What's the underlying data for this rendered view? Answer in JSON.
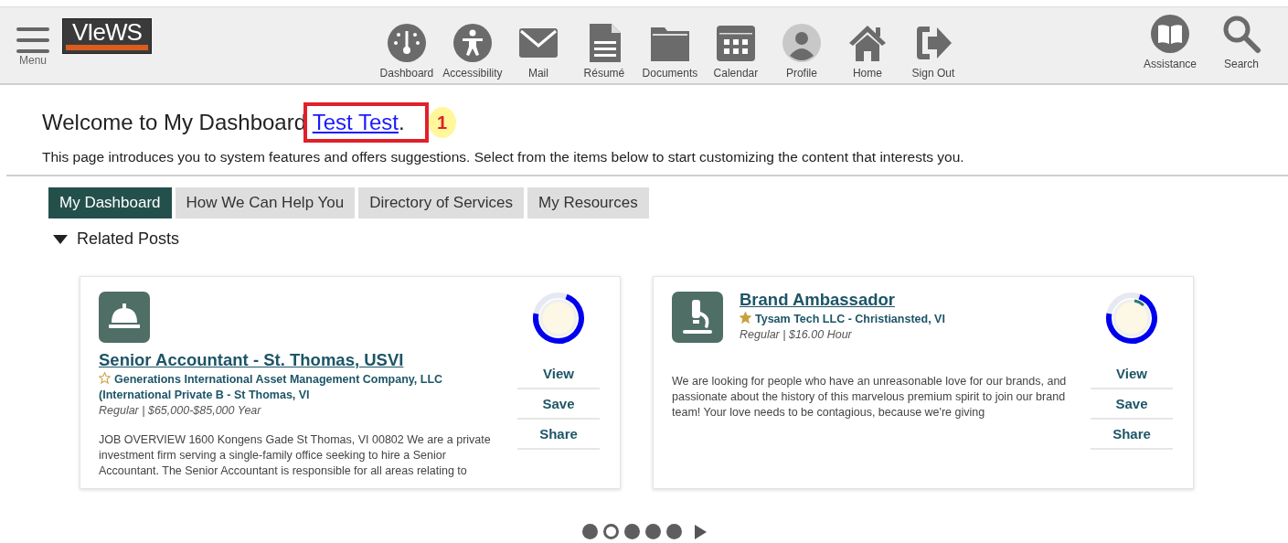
{
  "header": {
    "menu_label": "Menu",
    "logo": "VIeWS",
    "nav": [
      {
        "kind": "dashboard",
        "label": "Dashboard"
      },
      {
        "kind": "accessibility",
        "label": "Accessibility"
      },
      {
        "kind": "mail",
        "label": "Mail"
      },
      {
        "kind": "resume",
        "label": "Résumé"
      },
      {
        "kind": "documents",
        "label": "Documents"
      },
      {
        "kind": "calendar",
        "label": "Calendar"
      },
      {
        "kind": "profile",
        "label": "Profile"
      },
      {
        "kind": "home",
        "label": "Home"
      },
      {
        "kind": "signout",
        "label": "Sign Out"
      }
    ],
    "tools": [
      {
        "kind": "assistance",
        "label": "Assistance"
      },
      {
        "kind": "search",
        "label": "Search"
      }
    ]
  },
  "welcome": {
    "text": "Welcome to My Dashboard",
    "user_link": "Test Test",
    "end": ".",
    "callout": "1"
  },
  "intro": "This page introduces you to system features and offers suggestions. Select from the items below to start customizing the content that interests you.",
  "tabs": [
    {
      "label": "My Dashboard",
      "selected": true
    },
    {
      "label": "How We Can Help You",
      "selected": false
    },
    {
      "label": "Directory of Services",
      "selected": false
    },
    {
      "label": "My Resources",
      "selected": false
    }
  ],
  "section": {
    "title": "Related Posts",
    "expanded": true
  },
  "posts": [
    {
      "kind": "service",
      "title": "Senior Accountant - St. Thomas, USVI",
      "favorite": false,
      "company": "Generations International Asset Management Company, LLC (International Private B - St Thomas, VI",
      "terms": "Regular | $65,000-$85,000 Year",
      "description": "JOB OVERVIEW 1600 Kongens Gade St Thomas, VI 00802 We are a private investment firm serving a single-family office seeking to hire a Senior Accountant. The Senior Accountant is responsible for all areas relating to",
      "actions": [
        "View",
        "Save",
        "Share"
      ]
    },
    {
      "kind": "science",
      "title": "Brand Ambassador",
      "favorite": true,
      "company": "Tysam Tech LLC - Christiansted, VI",
      "terms": "Regular | $16.00 Hour",
      "description": "We are looking for people who have an unreasonable love for our brands, and passionate about the history of this marvelous premium spirit to join our brand team! Your love needs to be contagious, because we're giving",
      "actions": [
        "View",
        "Save",
        "Share"
      ]
    }
  ],
  "pager": [
    {
      "selected": false
    },
    {
      "selected": true
    },
    {
      "selected": false
    },
    {
      "selected": false
    },
    {
      "selected": false
    }
  ]
}
